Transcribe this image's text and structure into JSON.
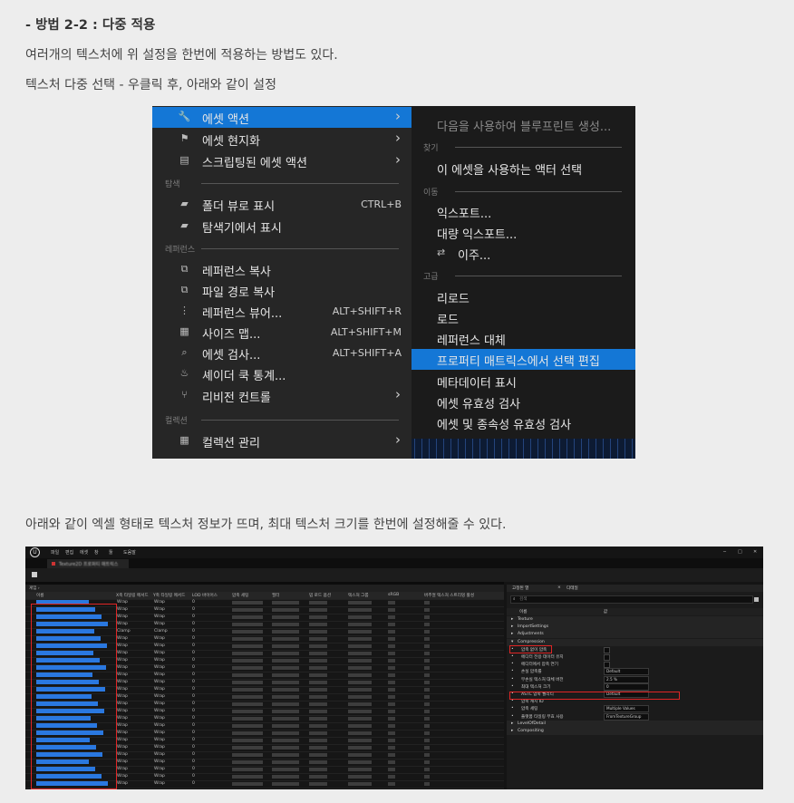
{
  "heading": "- 방법 2-2 : 다중 적용",
  "para1": "여러개의 텍스처에 위 설정을 한번에 적용하는 방법도 있다.",
  "para2": "텍스처 다중 선택 - 우클릭 후, 아래와 같이 설정",
  "para3": "아래와 같이 엑셀 형태로 텍스처 정보가 뜨며, 최대 텍스처 크기를 한번에 설정해줄 수 있다.",
  "context_menu": {
    "left": {
      "asset_actions": "에셋 액션",
      "localize": "에셋 현지화",
      "scripted_actions": "스크립팅된 에셋 액션",
      "sec_browse": "탐색",
      "show_in_folder_view": "폴더 뷰로 표시",
      "folder_view_shortcut": "CTRL+B",
      "show_in_explorer": "탐색기에서 표시",
      "sec_references": "레퍼런스",
      "copy_reference": "레퍼런스 복사",
      "copy_file_path": "파일 경로 복사",
      "reference_viewer": "레퍼런스 뷰어...",
      "reference_viewer_shortcut": "ALT+SHIFT+R",
      "size_map": "사이즈 맵...",
      "size_map_shortcut": "ALT+SHIFT+M",
      "audit_assets": "에셋 검사...",
      "audit_assets_shortcut": "ALT+SHIFT+A",
      "shader_cook_stats": "셰이더 쿡 통계...",
      "revision_control": "리비전 컨트롤",
      "sec_collections": "컬렉션",
      "manage_collections": "컬렉션 관리"
    },
    "right": {
      "create_blueprint": "다음을 사용하여 블루프린트 생성...",
      "sec_find": "찾기",
      "select_actors": "이 에셋을 사용하는 액터 선택",
      "sec_move": "이동",
      "export": "익스포트...",
      "bulk_export": "대량 익스포트...",
      "migrate": "이주...",
      "sec_advanced": "고급",
      "reload": "리로드",
      "load": "로드",
      "replace_references": "레퍼런스 대체",
      "property_matrix": "프로퍼티 매트릭스에서 선택 편집",
      "show_metadata": "메타데이터 표시",
      "validate_assets": "에셋 유효성 검사",
      "validate_deps": "에셋 및 종속성 유효성 검사"
    }
  },
  "editor": {
    "menu": [
      "파일",
      "편집",
      "에셋",
      "창",
      "툴",
      "도움말"
    ],
    "window_controls": [
      "─",
      "□",
      "✕"
    ],
    "tab_title": "Texture2D 프로퍼티 매트릭스",
    "columns": [
      "이름",
      "X축 타일링 메서드",
      "Y축 타일링 메서드",
      "LOD 바이어스",
      "압축 세팅",
      "필터",
      "밉 로드 옵션",
      "텍스처 그룹",
      "sRGB",
      "버추얼 텍스처 스트리밍 활성"
    ],
    "rows": [
      {
        "x": "Wrap",
        "y": "Wrap",
        "lod": "0"
      },
      {
        "x": "Wrap",
        "y": "Wrap",
        "lod": "0"
      },
      {
        "x": "Wrap",
        "y": "Wrap",
        "lod": "0"
      },
      {
        "x": "Wrap",
        "y": "Wrap",
        "lod": "0"
      },
      {
        "x": "Clamp",
        "y": "Clamp",
        "lod": "0"
      },
      {
        "x": "Wrap",
        "y": "Wrap",
        "lod": "0"
      },
      {
        "x": "Wrap",
        "y": "Wrap",
        "lod": "0"
      },
      {
        "x": "Wrap",
        "y": "Wrap",
        "lod": "0"
      },
      {
        "x": "Wrap",
        "y": "Wrap",
        "lod": "0"
      },
      {
        "x": "Wrap",
        "y": "Wrap",
        "lod": "0"
      },
      {
        "x": "Wrap",
        "y": "Wrap",
        "lod": "0"
      },
      {
        "x": "Wrap",
        "y": "Wrap",
        "lod": "0"
      },
      {
        "x": "Wrap",
        "y": "Wrap",
        "lod": "0"
      },
      {
        "x": "Wrap",
        "y": "Wrap",
        "lod": "0"
      },
      {
        "x": "Wrap",
        "y": "Wrap",
        "lod": "0"
      },
      {
        "x": "Wrap",
        "y": "Wrap",
        "lod": "0"
      },
      {
        "x": "Wrap",
        "y": "Wrap",
        "lod": "0"
      },
      {
        "x": "Wrap",
        "y": "Wrap",
        "lod": "0"
      },
      {
        "x": "Wrap",
        "y": "Wrap",
        "lod": "0"
      },
      {
        "x": "Wrap",
        "y": "Wrap",
        "lod": "0"
      },
      {
        "x": "Wrap",
        "y": "Wrap",
        "lod": "0"
      },
      {
        "x": "Wrap",
        "y": "Wrap",
        "lod": "0"
      },
      {
        "x": "Wrap",
        "y": "Wrap",
        "lod": "0"
      },
      {
        "x": "Wrap",
        "y": "Wrap",
        "lod": "0"
      },
      {
        "x": "Wrap",
        "y": "Wrap",
        "lod": "0"
      },
      {
        "x": "Wrap",
        "y": "Wrap",
        "lod": "0"
      }
    ],
    "details_tabs": [
      "고정된 열",
      "디테일"
    ],
    "search_placeholder": "검색",
    "details_header": [
      "이름",
      "값"
    ],
    "details_rows": [
      {
        "label": "Texture",
        "kind": "cat"
      },
      {
        "label": "ImportSettings",
        "kind": "cat"
      },
      {
        "label": "Adjustments",
        "kind": "cat"
      },
      {
        "label": "Compression",
        "kind": "cat-open"
      },
      {
        "label": "압축 없이 압축",
        "kind": "check"
      },
      {
        "label": "에디터 전용 데이터 유지",
        "kind": "check"
      },
      {
        "label": "에디터에서 압축 연기",
        "kind": "check"
      },
      {
        "label": "손실 압축률",
        "kind": "val",
        "value": "Default"
      },
      {
        "label": "무손실 텍스처 대체 버전",
        "kind": "val",
        "value": "2.5 %"
      },
      {
        "label": "최대 텍스처 크기",
        "kind": "val",
        "value": "0"
      },
      {
        "label": "ASTC 압축 퀄리티",
        "kind": "val",
        "value": "Default"
      },
      {
        "label": "압축 캐시 ID",
        "kind": "plain"
      },
      {
        "label": "압축 세팅",
        "kind": "val",
        "value": "Multiple Values"
      },
      {
        "label": "플랫폼 타일링 무효 사용",
        "kind": "val",
        "value": "FromTextureGroup"
      },
      {
        "label": "LevelOfDetail",
        "kind": "cat"
      },
      {
        "label": "Compositing",
        "kind": "cat"
      }
    ]
  }
}
